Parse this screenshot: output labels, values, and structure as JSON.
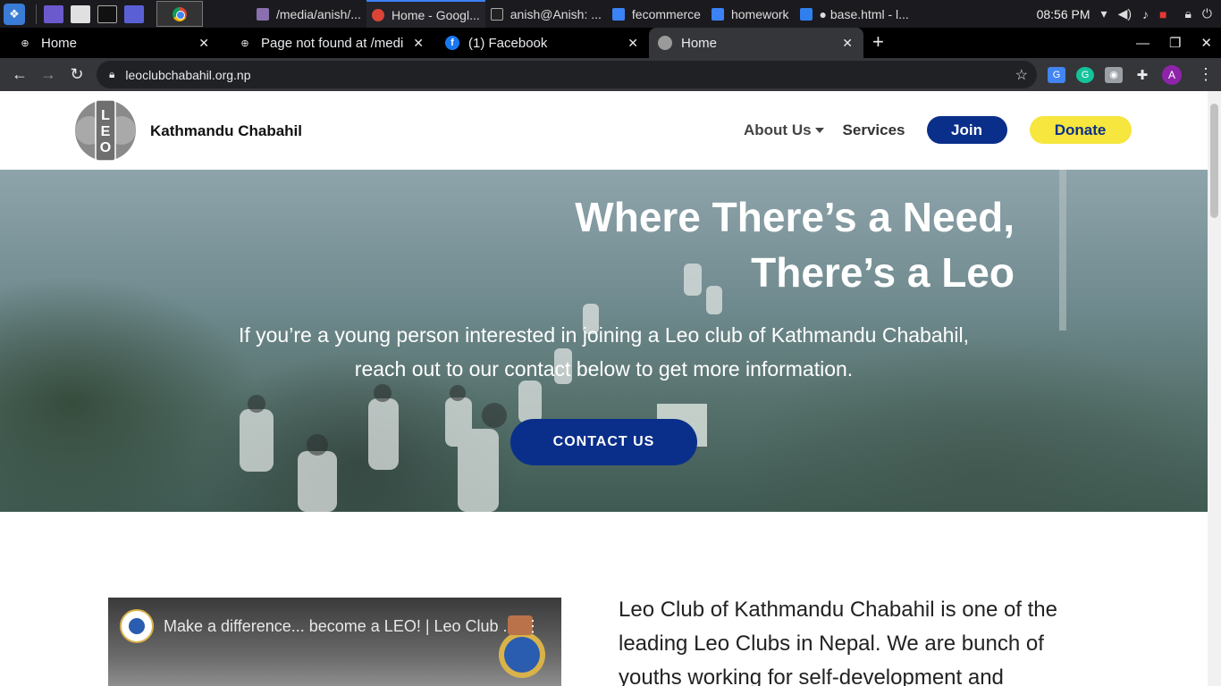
{
  "taskbar": {
    "tasks": [
      {
        "label": "/media/anish/...",
        "color": "#8a6fb0"
      },
      {
        "label": "Home - Googl...",
        "color": "#db4437",
        "active": true
      },
      {
        "label": "anish@Anish: ...",
        "color": "#333333"
      },
      {
        "label": "fecommerce",
        "color": "#3b82f6"
      },
      {
        "label": "homework",
        "color": "#3b82f6"
      },
      {
        "label": "● base.html - l...",
        "color": "#2f80ed"
      }
    ],
    "clock": "08:56 PM"
  },
  "browser": {
    "tabs": [
      {
        "label": "Home",
        "favicon": "globe-icon"
      },
      {
        "label": "Page not found at /media/i",
        "favicon": "globe-icon"
      },
      {
        "label": "(1) Facebook",
        "favicon": "facebook-icon"
      },
      {
        "label": "Home",
        "favicon": "lions-icon",
        "active": true
      }
    ],
    "url": "leoclubchabahil.org.np",
    "profile_initial": "A"
  },
  "site": {
    "brand": "Kathmandu Chabahil",
    "nav": {
      "about": "About Us",
      "services": "Services",
      "join": "Join",
      "donate": "Donate"
    },
    "hero": {
      "title_line1": "Where There’s a Need,",
      "title_line2": "There’s a Leo",
      "subtitle_line1": "If you’re a young person interested in joining a Leo club of Kathmandu Chabahil,",
      "subtitle_line2": "reach out to our contact below to get more information.",
      "cta": "CONTACT US"
    },
    "video": {
      "title": "Make a difference... become a LEO! | Leo Club ..."
    },
    "about": {
      "text": "Leo Club of Kathmandu Chabahil is one of the leading Leo Clubs in Nepal. We are bunch of youths working for self-development and"
    }
  },
  "colors": {
    "brand_blue": "#0a2f8a",
    "donate_yellow": "#f6e63d"
  }
}
